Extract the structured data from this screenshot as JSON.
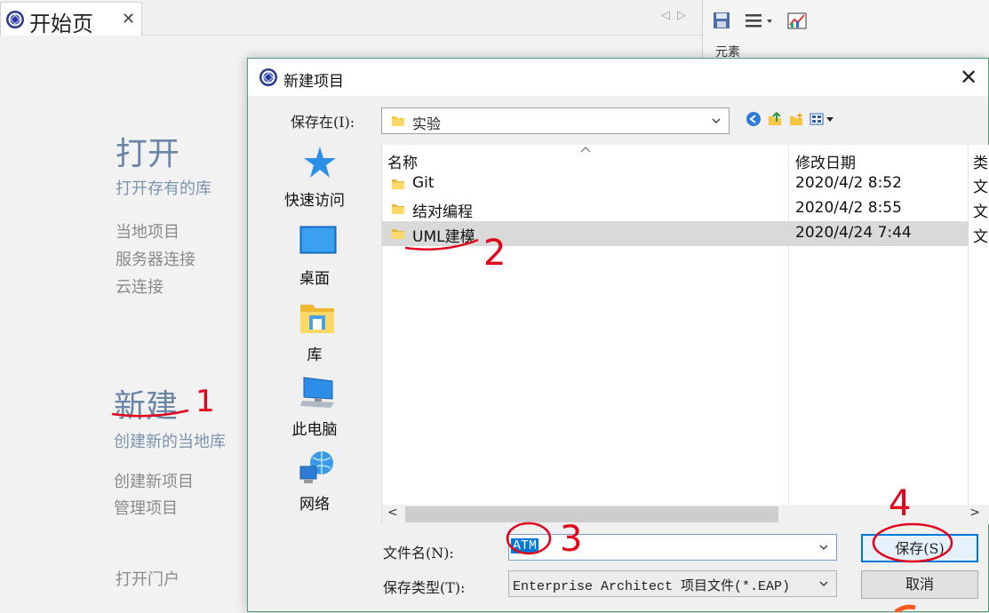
{
  "start_tab": {
    "title": "开始页",
    "close": "✕"
  },
  "start_page": {
    "open_heading": "打开",
    "open_sub": "打开存有的库",
    "open_items": [
      "当地项目",
      "服务器连接",
      "云连接"
    ],
    "new_heading": "新建",
    "new_sub": "创建新的当地库",
    "new_items": [
      "创建新项目",
      "管理项目"
    ],
    "portal": "打开门户"
  },
  "right_panel": {
    "label": "元素"
  },
  "dialog": {
    "title": "新建项目",
    "close": "✕",
    "save_in_label": "保存在(I):",
    "save_in_value": "实验",
    "places": [
      "快速访问",
      "桌面",
      "库",
      "此电脑",
      "网络"
    ],
    "columns": [
      "名称",
      "修改日期",
      "类"
    ],
    "files": [
      {
        "name": "Git",
        "date": "2020/4/2 8:52",
        "type": "文"
      },
      {
        "name": "结对编程",
        "date": "2020/4/2 8:55",
        "type": "文"
      },
      {
        "name": "UML建模",
        "date": "2020/4/24 7:44",
        "type": "文"
      }
    ],
    "filename_label": "文件名(N):",
    "filename_value": "ATM",
    "filetype_label": "保存类型(T):",
    "filetype_value": "Enterprise Architect 项目文件(*.EAP)",
    "save_button": "保存(S)",
    "cancel_button": "取消"
  },
  "colors": {
    "accent": "#0078d7",
    "annotation": "#e2001a",
    "link_blue": "#6a85a7"
  },
  "annotations": [
    "1",
    "2",
    "3",
    "4"
  ]
}
